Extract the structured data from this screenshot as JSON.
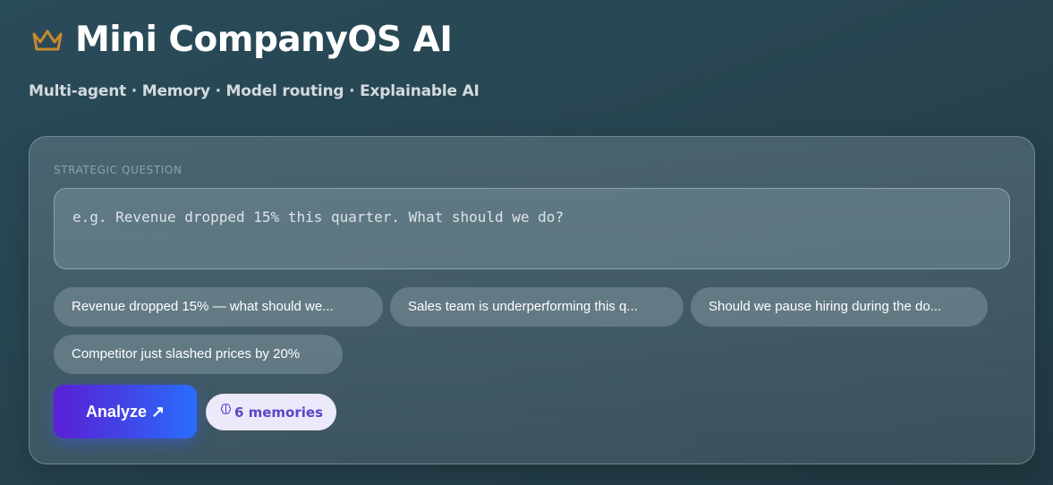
{
  "header": {
    "title": "Mini CompanyOS AI",
    "subtitle": "Multi-agent · Memory · Model routing · Explainable AI",
    "logo_icon": "crown-icon"
  },
  "question": {
    "label": "STRATEGIC QUESTION",
    "placeholder": "e.g. Revenue dropped 15% this quarter. What should we do?",
    "value": ""
  },
  "suggestions": [
    {
      "label": "Revenue dropped 15% — what should we..."
    },
    {
      "label": "Sales team is underperforming this q..."
    },
    {
      "label": "Should we pause hiring during the do..."
    },
    {
      "label": "Competitor just slashed prices by 20%"
    }
  ],
  "actions": {
    "analyze_label": "Analyze ↗",
    "memories_label": "6 memories",
    "memories_icon": "brain-icon"
  },
  "colors": {
    "background": "#27444f",
    "accent_crown": "#c8892f",
    "button_start": "#5a1fd6",
    "button_end": "#2a6dff",
    "badge_bg": "#ece9fb",
    "badge_text": "#5b46c7"
  }
}
